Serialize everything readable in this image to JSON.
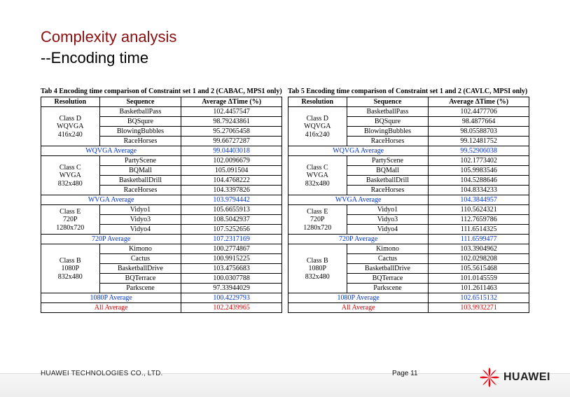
{
  "title": "Complexity analysis",
  "subtitle": "--Encoding time",
  "tables": [
    {
      "caption": "Tab 4 Encoding time comparison of Constraint set 1 and 2 (CABAC, MPS1 only)",
      "headers": [
        "Resolution",
        "Sequence",
        "Average ΔTime (%)"
      ],
      "groups": [
        {
          "resolution": "Class D\nWQVGA\n416x240",
          "rows": [
            [
              "BasketballPass",
              "102.4457547"
            ],
            [
              "BQSqure",
              "98.79243861"
            ],
            [
              "BlowingBubbles",
              "95.27065458"
            ],
            [
              "RaceHorses",
              "99.66727287"
            ]
          ],
          "average": [
            "WQVGA Average",
            "99.04403018"
          ]
        },
        {
          "resolution": "Class C\nWVGA\n832x480",
          "rows": [
            [
              "PartyScene",
              "102.0096679"
            ],
            [
              "BQMall",
              "105.091504"
            ],
            [
              "BasketballDrill",
              "104.4768222"
            ],
            [
              "RaceHorses",
              "104.3397826"
            ]
          ],
          "average": [
            "WVGA Average",
            "103.9794442"
          ]
        },
        {
          "resolution": "Class E\n720P\n1280x720",
          "rows": [
            [
              "Vidyo1",
              "105.6655913"
            ],
            [
              "Vidyo3",
              "108.5042937"
            ],
            [
              "Vidyo4",
              "107.5252656"
            ]
          ],
          "average": [
            "720P Average",
            "107.2317169"
          ]
        },
        {
          "resolution": "Class B\n1080P\n832x480",
          "rows": [
            [
              "Kimono",
              "100.2774867"
            ],
            [
              "Cactus",
              "100.9915225"
            ],
            [
              "BasketballDrive",
              "103.4756683"
            ],
            [
              "BQTerrace",
              "100.0307788"
            ],
            [
              "Parkscene",
              "97.33944029"
            ]
          ],
          "average": [
            "1080P Average",
            "100.4229793"
          ]
        }
      ],
      "all_average": [
        "All Average",
        "102.2439965"
      ]
    },
    {
      "caption": "Tab 5 Encoding time comparison of Constraint set 1 and 2 (CAVLC, MPSI only)",
      "headers": [
        "Resolution",
        "Sequence",
        "Average ΔTime (%)"
      ],
      "groups": [
        {
          "resolution": "Class D\nWQVGA\n416x240",
          "rows": [
            [
              "BasketballPass",
              "102.4477706"
            ],
            [
              "BQSqure",
              "98.4877664"
            ],
            [
              "BlowingBubbles",
              "98.05588703"
            ],
            [
              "RaceHorses",
              "99.12481752"
            ]
          ],
          "average": [
            "WQVGA Average",
            "99.52906038"
          ]
        },
        {
          "resolution": "Class C\nWVGA\n832x480",
          "rows": [
            [
              "PartyScene",
              "102.1773402"
            ],
            [
              "BQMall",
              "105.9983546"
            ],
            [
              "BasketballDrill",
              "104.5288646"
            ],
            [
              "RaceHorses",
              "104.8334233"
            ]
          ],
          "average": [
            "WVGA Average",
            "104.3844957"
          ]
        },
        {
          "resolution": "Class E\n720P\n1280x720",
          "rows": [
            [
              "Vidyo1",
              "110.5624321"
            ],
            [
              "Vidyo3",
              "112.7659786"
            ],
            [
              "Vidyo4",
              "111.6514325"
            ]
          ],
          "average": [
            "720P Average",
            "111.6599477"
          ]
        },
        {
          "resolution": "Class B\n1080P\n832x480",
          "rows": [
            [
              "Kimono",
              "103.3904962"
            ],
            [
              "Cactus",
              "102.0298208"
            ],
            [
              "BasketballDrive",
              "105.5615468"
            ],
            [
              "BQTerrace",
              "101.0145559"
            ],
            [
              "Parkscene",
              "101.2611463"
            ]
          ],
          "average": [
            "1080P Average",
            "102.6515132"
          ]
        }
      ],
      "all_average": [
        "All Average",
        "103.9932271"
      ]
    }
  ],
  "footer": {
    "company": "HUAWEI TECHNOLOGIES CO., LTD.",
    "page": "Page 11",
    "logo_text": "HUAWEI"
  },
  "chart_data": [
    {
      "type": "table",
      "title": "Tab 4 Encoding time comparison of Constraint set 1 and 2 (CABAC, MPS1 only)",
      "columns": [
        "Resolution",
        "Sequence",
        "Average ΔTime (%)"
      ],
      "rows": [
        [
          "Class D WQVGA 416x240",
          "BasketballPass",
          102.4457547
        ],
        [
          "Class D WQVGA 416x240",
          "BQSqure",
          98.79243861
        ],
        [
          "Class D WQVGA 416x240",
          "BlowingBubbles",
          95.27065458
        ],
        [
          "Class D WQVGA 416x240",
          "RaceHorses",
          99.66727287
        ],
        [
          "WQVGA Average",
          "",
          99.04403018
        ],
        [
          "Class C WVGA 832x480",
          "PartyScene",
          102.0096679
        ],
        [
          "Class C WVGA 832x480",
          "BQMall",
          105.091504
        ],
        [
          "Class C WVGA 832x480",
          "BasketballDrill",
          104.4768222
        ],
        [
          "Class C WVGA 832x480",
          "RaceHorses",
          104.3397826
        ],
        [
          "WVGA Average",
          "",
          103.9794442
        ],
        [
          "Class E 720P 1280x720",
          "Vidyo1",
          105.6655913
        ],
        [
          "Class E 720P 1280x720",
          "Vidyo3",
          108.5042937
        ],
        [
          "Class E 720P 1280x720",
          "Vidyo4",
          107.5252656
        ],
        [
          "720P Average",
          "",
          107.2317169
        ],
        [
          "Class B 1080P 832x480",
          "Kimono",
          100.2774867
        ],
        [
          "Class B 1080P 832x480",
          "Cactus",
          100.9915225
        ],
        [
          "Class B 1080P 832x480",
          "BasketballDrive",
          103.4756683
        ],
        [
          "Class B 1080P 832x480",
          "BQTerrace",
          100.0307788
        ],
        [
          "Class B 1080P 832x480",
          "Parkscene",
          97.33944029
        ],
        [
          "1080P Average",
          "",
          100.4229793
        ],
        [
          "All Average",
          "",
          102.2439965
        ]
      ]
    },
    {
      "type": "table",
      "title": "Tab 5 Encoding time comparison of Constraint set 1 and 2 (CAVLC, MPSI only)",
      "columns": [
        "Resolution",
        "Sequence",
        "Average ΔTime (%)"
      ],
      "rows": [
        [
          "Class D WQVGA 416x240",
          "BasketballPass",
          102.4477706
        ],
        [
          "Class D WQVGA 416x240",
          "BQSqure",
          98.4877664
        ],
        [
          "Class D WQVGA 416x240",
          "BlowingBubbles",
          98.05588703
        ],
        [
          "Class D WQVGA 416x240",
          "RaceHorses",
          99.12481752
        ],
        [
          "WQVGA Average",
          "",
          99.52906038
        ],
        [
          "Class C WVGA 832x480",
          "PartyScene",
          102.1773402
        ],
        [
          "Class C WVGA 832x480",
          "BQMall",
          105.9983546
        ],
        [
          "Class C WVGA 832x480",
          "BasketballDrill",
          104.5288646
        ],
        [
          "Class C WVGA 832x480",
          "RaceHorses",
          104.8334233
        ],
        [
          "WVGA Average",
          "",
          104.3844957
        ],
        [
          "Class E 720P 1280x720",
          "Vidyo1",
          110.5624321
        ],
        [
          "Class E 720P 1280x720",
          "Vidyo3",
          112.7659786
        ],
        [
          "Class E 720P 1280x720",
          "Vidyo4",
          111.6514325
        ],
        [
          "720P Average",
          "",
          111.6599477
        ],
        [
          "Class B 1080P 832x480",
          "Kimono",
          103.3904962
        ],
        [
          "Class B 1080P 832x480",
          "Cactus",
          102.0298208
        ],
        [
          "Class B 1080P 832x480",
          "BasketballDrive",
          105.5615468
        ],
        [
          "Class B 1080P 832x480",
          "BQTerrace",
          101.0145559
        ],
        [
          "Class B 1080P 832x480",
          "Parkscene",
          101.2611463
        ],
        [
          "1080P Average",
          "",
          102.6515132
        ],
        [
          "All Average",
          "",
          103.9932271
        ]
      ]
    }
  ]
}
